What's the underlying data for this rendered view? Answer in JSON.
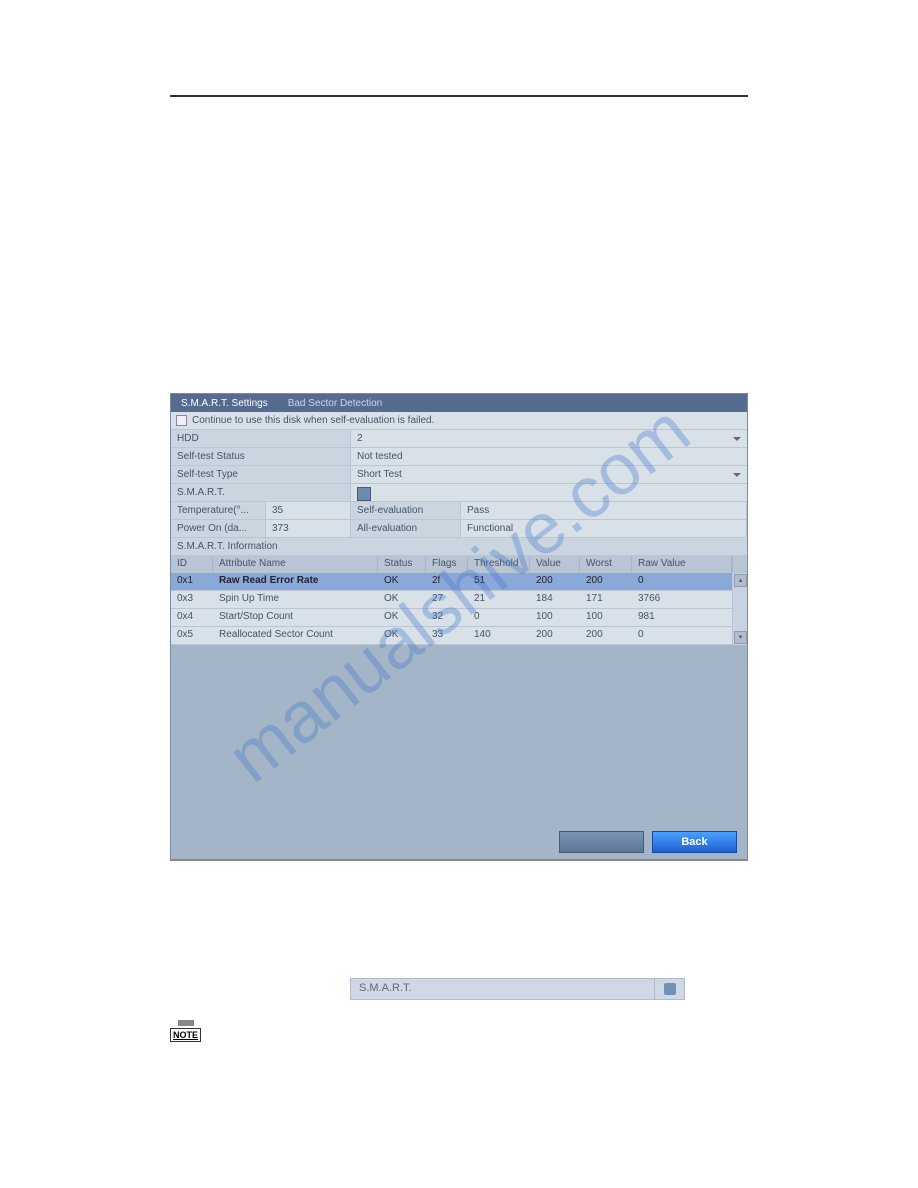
{
  "tabs": {
    "smart": "S.M.A.R.T. Settings",
    "bad_sector": "Bad Sector Detection"
  },
  "checkbox_label": "Continue to use this disk when self-evaluation is failed.",
  "fields": {
    "hdd": {
      "label": "HDD",
      "value": "2"
    },
    "self_test_status": {
      "label": "Self-test Status",
      "value": "Not tested"
    },
    "self_test_type": {
      "label": "Self-test Type",
      "value": "Short Test"
    },
    "smart": {
      "label": "S.M.A.R.T."
    }
  },
  "metrics": {
    "temperature": {
      "label": "Temperature(°...",
      "value": "35"
    },
    "self_eval": {
      "label": "Self-evaluation",
      "value": "Pass"
    },
    "power_on": {
      "label": "Power On (da...",
      "value": "373"
    },
    "all_eval": {
      "label": "All-evaluation",
      "value": "Functional"
    }
  },
  "smart_info_header": "S.M.A.R.T. Information",
  "columns": {
    "id": "ID",
    "attr": "Attribute Name",
    "status": "Status",
    "flags": "Flags",
    "threshold": "Threshold",
    "value": "Value",
    "worst": "Worst",
    "raw": "Raw Value"
  },
  "rows": [
    {
      "id": "0x1",
      "attr": "Raw Read Error Rate",
      "status": "OK",
      "flags": "2f",
      "threshold": "51",
      "value": "200",
      "worst": "200",
      "raw": "0"
    },
    {
      "id": "0x3",
      "attr": "Spin Up Time",
      "status": "OK",
      "flags": "27",
      "threshold": "21",
      "value": "184",
      "worst": "171",
      "raw": "3766"
    },
    {
      "id": "0x4",
      "attr": "Start/Stop Count",
      "status": "OK",
      "flags": "32",
      "threshold": "0",
      "value": "100",
      "worst": "100",
      "raw": "981"
    },
    {
      "id": "0x5",
      "attr": "Reallocated Sector Count",
      "status": "OK",
      "flags": "33",
      "threshold": "140",
      "value": "200",
      "worst": "200",
      "raw": "0"
    }
  ],
  "buttons": {
    "apply": "",
    "back": "Back"
  },
  "snippet_label": "S.M.A.R.T.",
  "note_text": "NOTE",
  "watermark": "manualshive.com"
}
